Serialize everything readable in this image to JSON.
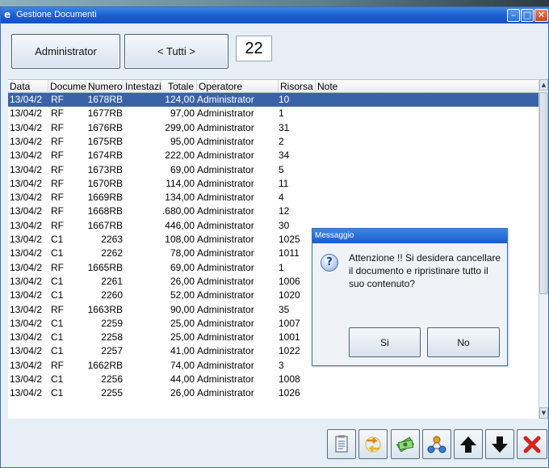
{
  "window": {
    "title": "Gestione Documenti",
    "icon": "e",
    "min_glyph": "–",
    "max_glyph": "□",
    "close_glyph": "✕"
  },
  "toolbar": {
    "user_button": "Administrator",
    "filter_button": "< Tutti >",
    "count": "22"
  },
  "grid": {
    "columns": [
      "Data",
      "Docume",
      "Numero",
      "Intestazi",
      "Totale",
      "Operatore",
      "Risorsa",
      "Note"
    ],
    "rows": [
      {
        "data": "13/04/2",
        "doc": "RF",
        "num": "1678RB",
        "tot": "124,00",
        "op": "Administrator",
        "res": "10"
      },
      {
        "data": "13/04/2",
        "doc": "RF",
        "num": "1677RB",
        "tot": "97,00",
        "op": "Administrator",
        "res": "1"
      },
      {
        "data": "13/04/2",
        "doc": "RF",
        "num": "1676RB",
        "tot": "299,00",
        "op": "Administrator",
        "res": "31"
      },
      {
        "data": "13/04/2",
        "doc": "RF",
        "num": "1675RB",
        "tot": "95,00",
        "op": "Administrator",
        "res": "2"
      },
      {
        "data": "13/04/2",
        "doc": "RF",
        "num": "1674RB",
        "tot": "222,00",
        "op": "Administrator",
        "res": "34"
      },
      {
        "data": "13/04/2",
        "doc": "RF",
        "num": "1673RB",
        "tot": "69,00",
        "op": "Administrator",
        "res": "5"
      },
      {
        "data": "13/04/2",
        "doc": "RF",
        "num": "1670RB",
        "tot": "114,00",
        "op": "Administrator",
        "res": "11"
      },
      {
        "data": "13/04/2",
        "doc": "RF",
        "num": "1669RB",
        "tot": "134,00",
        "op": "Administrator",
        "res": "4"
      },
      {
        "data": "13/04/2",
        "doc": "RF",
        "num": "1668RB",
        "tot": ".680,00",
        "op": "Administrator",
        "res": "12"
      },
      {
        "data": "13/04/2",
        "doc": "RF",
        "num": "1667RB",
        "tot": "446,00",
        "op": "Administrator",
        "res": "30"
      },
      {
        "data": "13/04/2",
        "doc": "C1",
        "num": "2263",
        "tot": "108,00",
        "op": "Administrator",
        "res": "1025"
      },
      {
        "data": "13/04/2",
        "doc": "C1",
        "num": "2262",
        "tot": "78,00",
        "op": "Administrator",
        "res": "1011"
      },
      {
        "data": "13/04/2",
        "doc": "RF",
        "num": "1665RB",
        "tot": "69,00",
        "op": "Administrator",
        "res": "1"
      },
      {
        "data": "13/04/2",
        "doc": "C1",
        "num": "2261",
        "tot": "26,00",
        "op": "Administrator",
        "res": "1006"
      },
      {
        "data": "13/04/2",
        "doc": "C1",
        "num": "2260",
        "tot": "52,00",
        "op": "Administrator",
        "res": "1020"
      },
      {
        "data": "13/04/2",
        "doc": "RF",
        "num": "1663RB",
        "tot": "90,00",
        "op": "Administrator",
        "res": "35"
      },
      {
        "data": "13/04/2",
        "doc": "C1",
        "num": "2259",
        "tot": "25,00",
        "op": "Administrator",
        "res": "1007"
      },
      {
        "data": "13/04/2",
        "doc": "C1",
        "num": "2258",
        "tot": "25,00",
        "op": "Administrator",
        "res": "1001"
      },
      {
        "data": "13/04/2",
        "doc": "C1",
        "num": "2257",
        "tot": "41,00",
        "op": "Administrator",
        "res": "1022"
      },
      {
        "data": "13/04/2",
        "doc": "RF",
        "num": "1662RB",
        "tot": "74,00",
        "op": "Administrator",
        "res": "3"
      },
      {
        "data": "13/04/2",
        "doc": "C1",
        "num": "2256",
        "tot": "44,00",
        "op": "Administrator",
        "res": "1008"
      },
      {
        "data": "13/04/2",
        "doc": "C1",
        "num": "2255",
        "tot": "26,00",
        "op": "Administrator",
        "res": "1026"
      }
    ]
  },
  "dialog": {
    "title": "Messaggio",
    "icon": "?",
    "message": "Attenzione !! Si desidera cancellare il documento e ripristinare tutto il suo contenuto?",
    "yes_label": "Si",
    "no_label": "No"
  },
  "bottom_toolbar": [
    "document-icon",
    "refresh-icon",
    "money-icon",
    "network-icon",
    "arrow-up-icon",
    "arrow-down-icon",
    "delete-x-icon"
  ],
  "colors": {
    "titlebar": "#1b5fd1",
    "selection": "#3a62a8",
    "background": "#e6eef6"
  }
}
